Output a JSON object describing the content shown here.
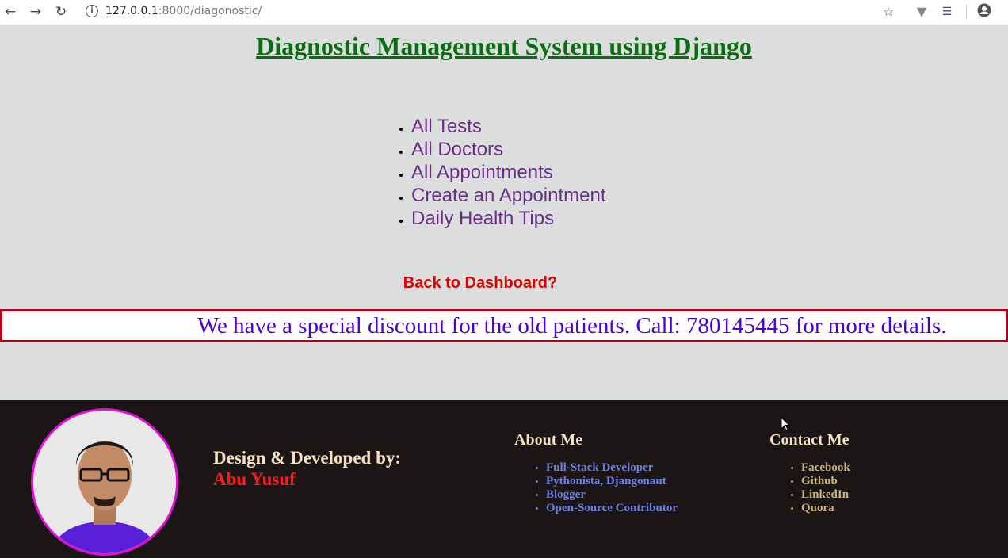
{
  "browser": {
    "url_host": "127.0.0.1",
    "url_rest": ":8000/diagonostic/",
    "icons": [
      "back-arrow-icon",
      "forward-arrow-icon",
      "reload-icon",
      "site-info-icon",
      "star-icon",
      "extension-v-icon",
      "extension-list-icon",
      "profile-icon"
    ]
  },
  "header": {
    "title": "Diagnostic Management System using Django"
  },
  "menu": {
    "items": [
      "All Tests",
      "All Doctors",
      "All Appointments",
      "Create an Appointment",
      "Daily Health Tips"
    ]
  },
  "back_link": "Back to Dashboard?",
  "marquee": {
    "text": "We have a special discount for the old patients. Call: 780145445 for more details."
  },
  "footer": {
    "developer_label": "Design & Developed by:",
    "developer_name": "Abu Yusuf",
    "about": {
      "title": "About Me",
      "items": [
        "Full-Stack Developer",
        "Pythonista, Djangonaut",
        "Blogger",
        "Open-Source Contributor"
      ]
    },
    "contact": {
      "title": "Contact Me",
      "items": [
        "Facebook",
        "Github",
        "LinkedIn",
        "Quora"
      ]
    }
  },
  "colors": {
    "title_green": "#0a6d12",
    "menu_purple": "#6a2e86",
    "back_red": "#e00000",
    "marquee_border": "#b0001e",
    "marquee_text": "#4b00d8",
    "footer_bg": "#1b1515"
  }
}
